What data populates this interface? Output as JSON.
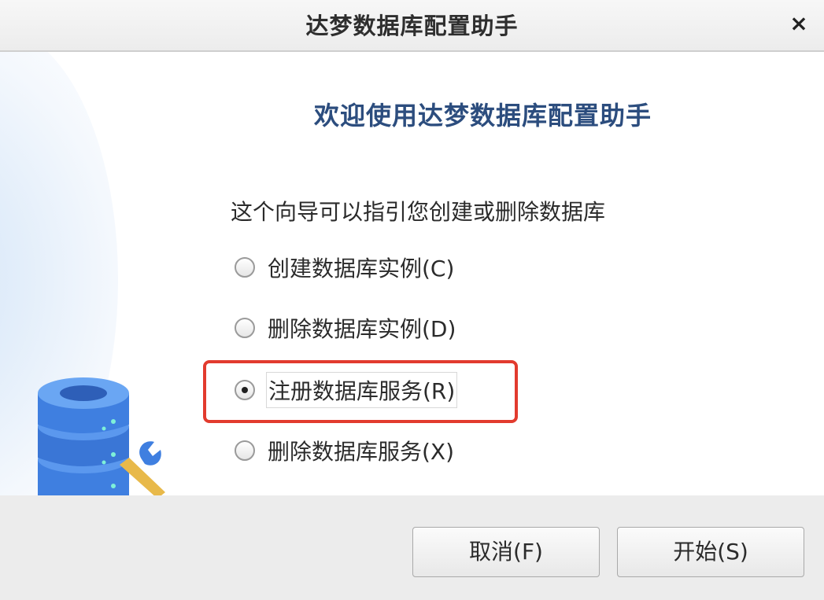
{
  "window": {
    "title": "达梦数据库配置助手",
    "close_label": "×"
  },
  "main": {
    "heading": "欢迎使用达梦数据库配置助手",
    "intro": "这个向导可以指引您创建或删除数据库",
    "options": [
      {
        "label": "创建数据库实例(C)",
        "selected": false
      },
      {
        "label": "删除数据库实例(D)",
        "selected": false
      },
      {
        "label": "注册数据库服务(R)",
        "selected": true
      },
      {
        "label": "删除数据库服务(X)",
        "selected": false
      }
    ]
  },
  "footer": {
    "cancel_label": "取消(F)",
    "start_label": "开始(S)"
  },
  "colors": {
    "heading": "#2c4d7e",
    "highlight": "#e23b2e",
    "db_blue": "#3f7fe0"
  },
  "icons": {
    "illustration": "database-wrench-icon",
    "close": "close-icon"
  }
}
